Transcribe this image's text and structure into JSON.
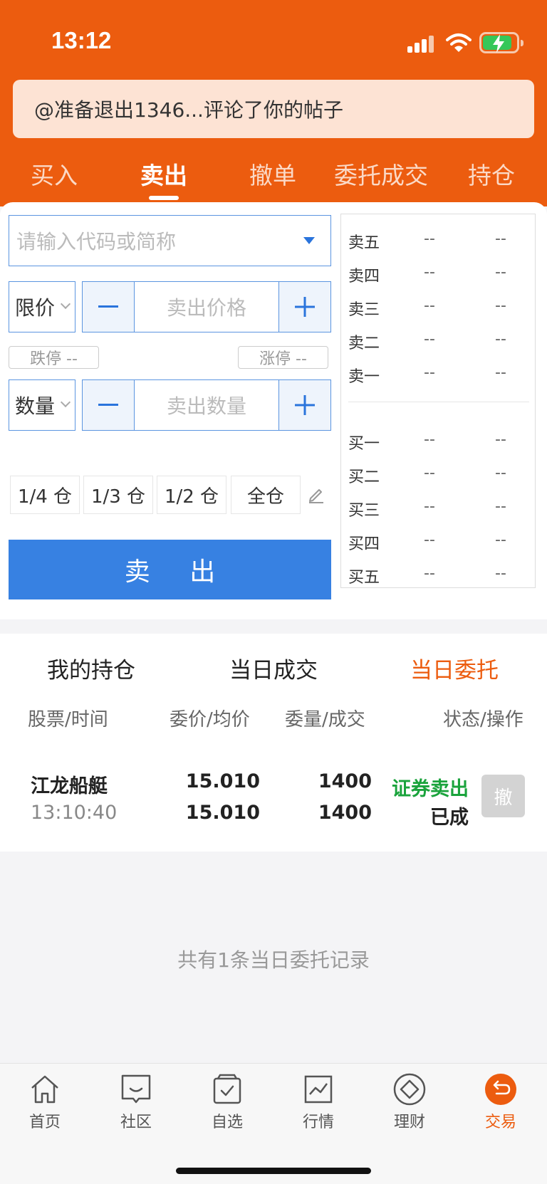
{
  "status_bar": {
    "time": "13:12"
  },
  "notification": {
    "text": "@准备退出1346...评论了你的帖子"
  },
  "tabs": [
    {
      "label": "买入",
      "active": false
    },
    {
      "label": "卖出",
      "active": true
    },
    {
      "label": "撤单",
      "active": false
    },
    {
      "label": "委托成交",
      "active": false
    },
    {
      "label": "持仓",
      "active": false
    }
  ],
  "form": {
    "code_placeholder": "请输入代码或简称",
    "price_type": "限价",
    "price_placeholder": "卖出价格",
    "limit_down": "跌停 --",
    "limit_up": "涨停 --",
    "qty_type": "数量",
    "qty_placeholder": "卖出数量",
    "positions": [
      "1/4 仓",
      "1/3 仓",
      "1/2 仓",
      "全仓"
    ],
    "submit_label": "卖 出"
  },
  "order_book": {
    "sell": [
      {
        "label": "卖五",
        "price": "--",
        "volume": "--"
      },
      {
        "label": "卖四",
        "price": "--",
        "volume": "--"
      },
      {
        "label": "卖三",
        "price": "--",
        "volume": "--"
      },
      {
        "label": "卖二",
        "price": "--",
        "volume": "--"
      },
      {
        "label": "卖一",
        "price": "--",
        "volume": "--"
      }
    ],
    "buy": [
      {
        "label": "买一",
        "price": "--",
        "volume": "--"
      },
      {
        "label": "买二",
        "price": "--",
        "volume": "--"
      },
      {
        "label": "买三",
        "price": "--",
        "volume": "--"
      },
      {
        "label": "买四",
        "price": "--",
        "volume": "--"
      },
      {
        "label": "买五",
        "price": "--",
        "volume": "--"
      }
    ]
  },
  "orders": {
    "tabs": [
      {
        "label": "我的持仓",
        "active": false
      },
      {
        "label": "当日成交",
        "active": false
      },
      {
        "label": "当日委托",
        "active": true
      }
    ],
    "columns": [
      "股票/时间",
      "委价/均价",
      "委量/成交",
      "状态/操作"
    ],
    "rows": [
      {
        "name": "江龙船艇",
        "time": "13:10:40",
        "order_price": "15.010",
        "avg_price": "15.010",
        "order_qty": "1400",
        "filled_qty": "1400",
        "type": "证券卖出",
        "status": "已成",
        "action": "撤"
      }
    ],
    "summary": "共有1条当日委托记录"
  },
  "bottom_nav": [
    {
      "label": "首页",
      "icon": "home-icon",
      "active": false
    },
    {
      "label": "社区",
      "icon": "community-icon",
      "active": false
    },
    {
      "label": "自选",
      "icon": "watchlist-icon",
      "active": false
    },
    {
      "label": "行情",
      "icon": "market-icon",
      "active": false
    },
    {
      "label": "理财",
      "icon": "wealth-icon",
      "active": false
    },
    {
      "label": "交易",
      "icon": "trade-icon",
      "active": true
    }
  ],
  "colors": {
    "brand": "#ec5c0f",
    "primary": "#3781e2",
    "success": "#1aa33c"
  }
}
